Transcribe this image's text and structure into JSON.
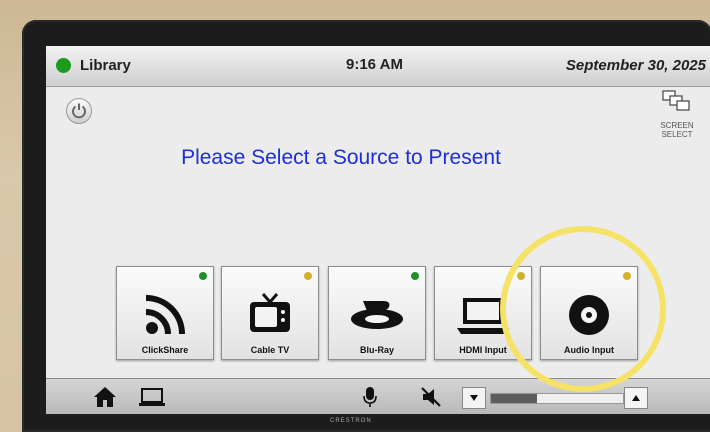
{
  "status_bar": {
    "room_name": "Library",
    "room_status_color": "#1e9a1e",
    "time": "9:16 AM",
    "date": "September 30, 2025"
  },
  "controls": {
    "power_icon": "power-icon",
    "screen_select_icon": "screen-select-icon",
    "screen_select_label": "SCREEN SELECT"
  },
  "prompt": "Please Select a Source to Present",
  "sources": [
    {
      "label": "ClickShare",
      "icon": "wireless-icon",
      "led_color": "#1f8f2a"
    },
    {
      "label": "Cable TV",
      "icon": "tv-icon",
      "led_color": "#d1b12a"
    },
    {
      "label": "Blu-Ray",
      "icon": "bluray-icon",
      "led_color": "#1f8f2a"
    },
    {
      "label": "HDMI Input",
      "icon": "laptop-icon",
      "led_color": "#d1b12a"
    },
    {
      "label": "Audio Input",
      "icon": "disc-icon",
      "led_color": "#d1b12a"
    }
  ],
  "bottom_bar": {
    "home_icon": "home-icon",
    "laptop_icon": "laptop-icon",
    "mic_icon": "microphone-icon",
    "mute_icon": "speaker-mute-icon",
    "volume_level": 0.35
  },
  "brand": "CRESTRON",
  "highlight_color": "#f6e267"
}
